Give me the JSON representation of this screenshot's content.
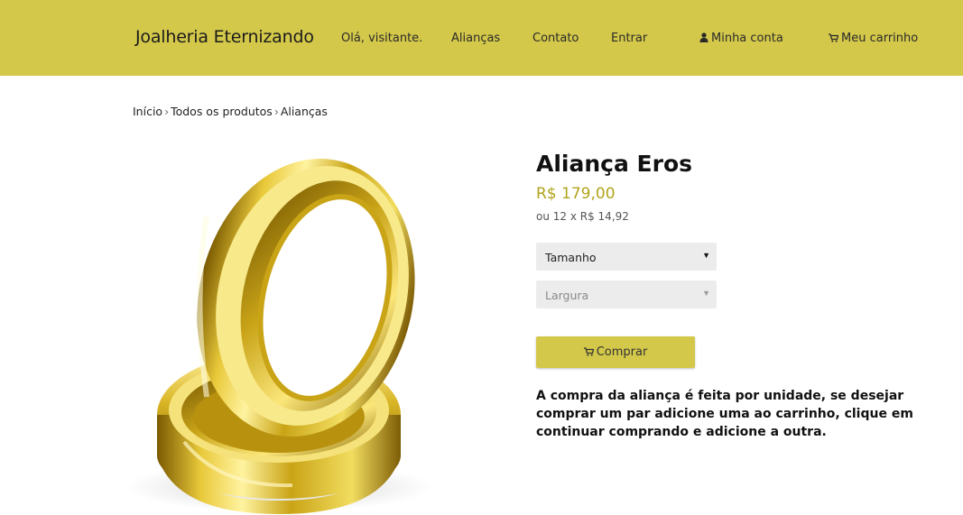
{
  "header": {
    "brand": "Joalheria Eternizando",
    "greeting": "Olá, visitante.",
    "nav": {
      "aliancas": "Alianças",
      "contato": "Contato",
      "entrar": "Entrar",
      "minha_conta": "Minha conta",
      "meu_carrinho": "Meu carrinho"
    },
    "icons": {
      "account": "user-icon",
      "cart": "cart-icon"
    },
    "background_color": "#d4c84a"
  },
  "breadcrumb": {
    "items": [
      "Início",
      "Todos os produtos",
      "Alianças"
    ],
    "separator": "›"
  },
  "product": {
    "title": "Aliança Eros",
    "price": "R$ 179,00",
    "installments": "ou 12 x R$ 14,92",
    "price_color": "#b1a41c",
    "image_icon": "gold-rings-image",
    "options": {
      "size_placeholder": "Tamanho",
      "width_placeholder": "Largura"
    },
    "buy_label": "Comprar",
    "buy_icon": "cart-icon",
    "note": "A compra da aliança é feita por unidade, se desejar comprar um par adicione uma ao carrinho, clique em continuar comprando e adicione a outra."
  }
}
